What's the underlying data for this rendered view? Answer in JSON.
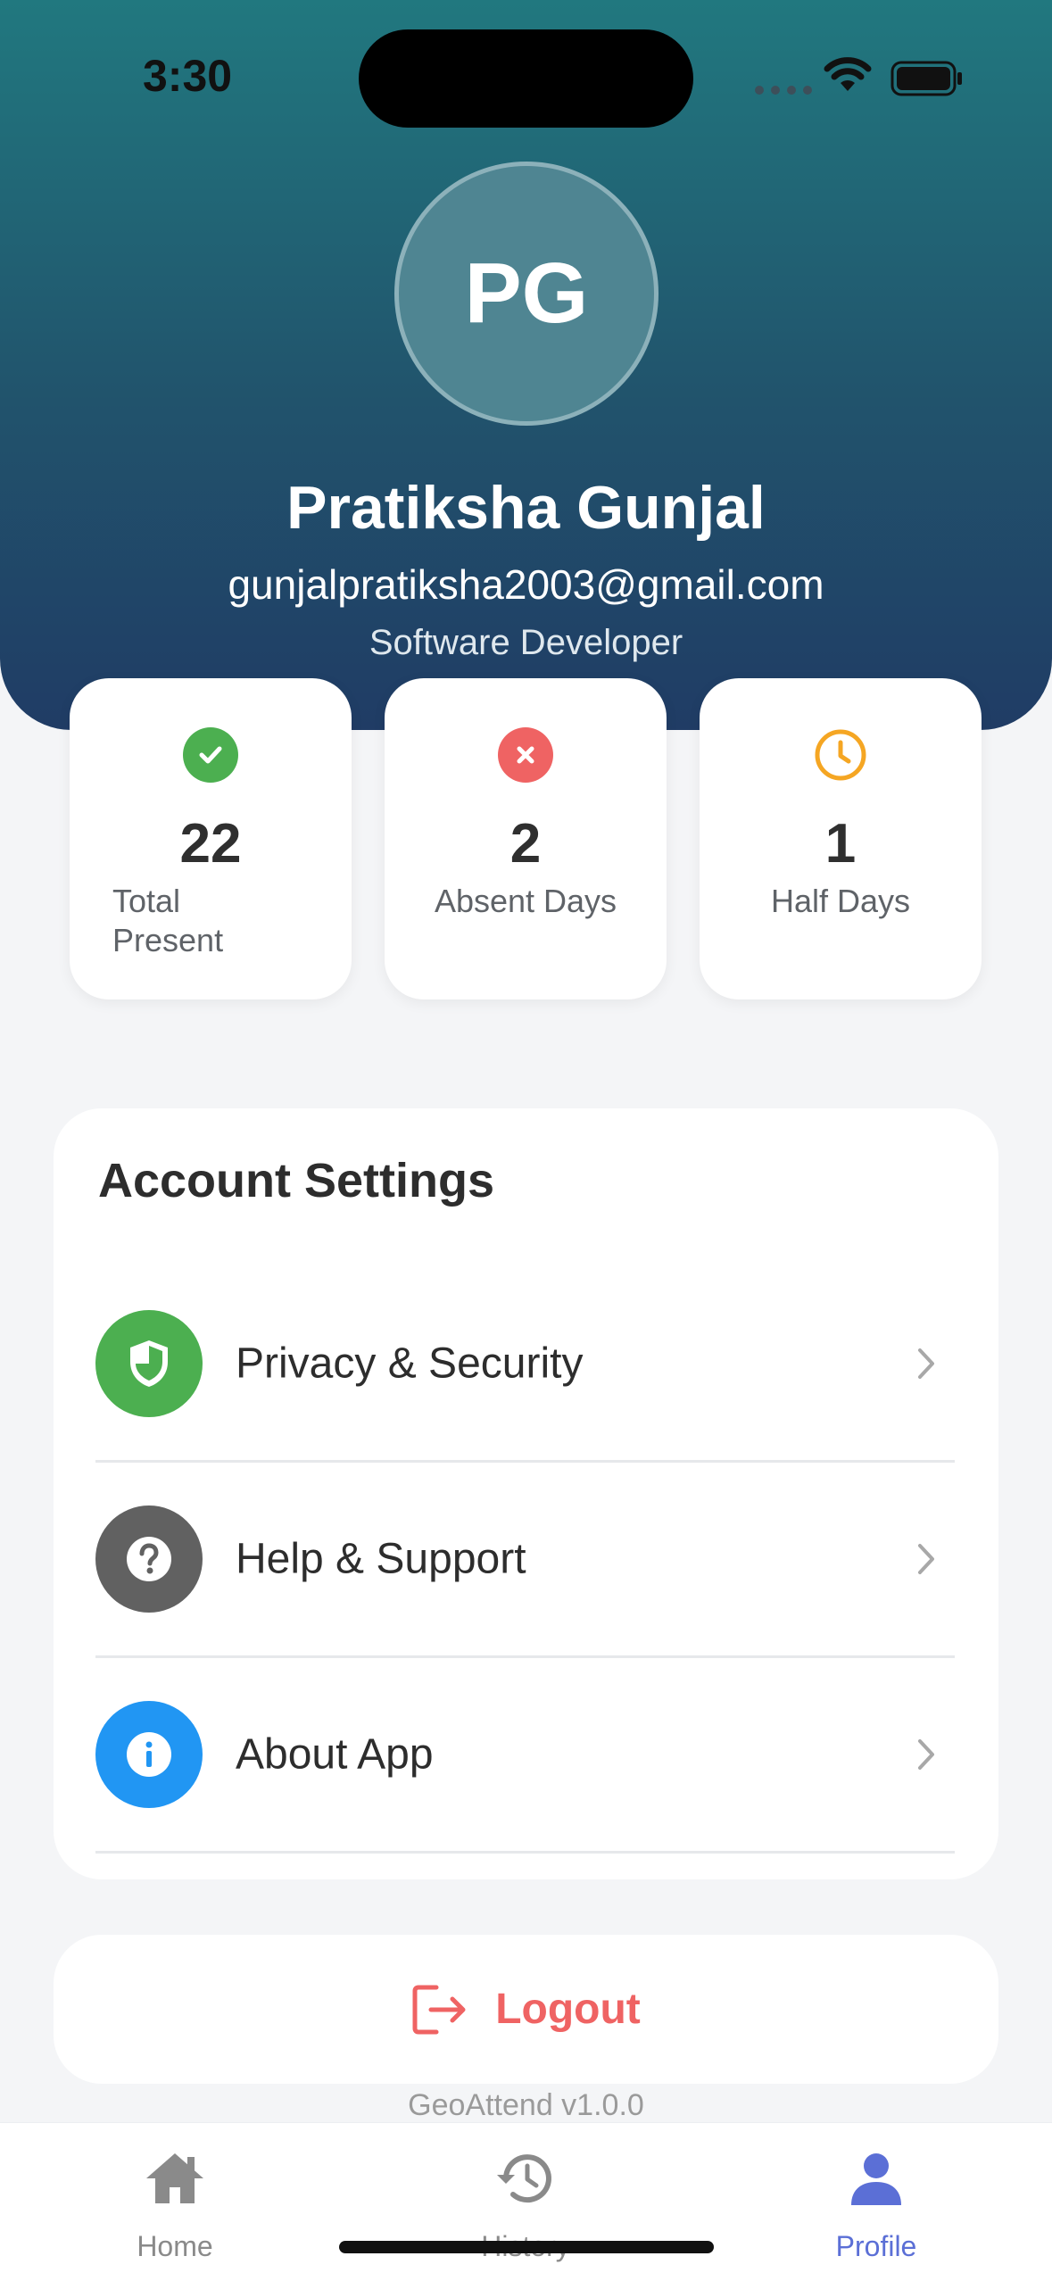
{
  "status_bar": {
    "time": "3:30"
  },
  "profile": {
    "initials": "PG",
    "name": "Pratiksha Gunjal",
    "email": "gunjalpratiksha2003@gmail.com",
    "role": "Software Developer"
  },
  "stats": [
    {
      "value": "22",
      "label": "Total Present",
      "icon": "check-circle-icon",
      "color": "#4caf50"
    },
    {
      "value": "2",
      "label": "Absent Days",
      "icon": "x-circle-icon",
      "color": "#ef6363"
    },
    {
      "value": "1",
      "label": "Half Days",
      "icon": "clock-icon",
      "color": "#f5a623"
    }
  ],
  "account_settings": {
    "title": "Account Settings",
    "items": [
      {
        "label": "Privacy & Security",
        "icon": "shield-icon",
        "color": "#4caf50"
      },
      {
        "label": "Help & Support",
        "icon": "question-icon",
        "color": "#616161"
      },
      {
        "label": "About App",
        "icon": "info-icon",
        "color": "#2196f3"
      }
    ]
  },
  "logout": {
    "label": "Logout",
    "color": "#ef6363"
  },
  "version": "GeoAttend v1.0.0",
  "tabs": [
    {
      "label": "Home",
      "icon": "home-icon"
    },
    {
      "label": "History",
      "icon": "history-icon"
    },
    {
      "label": "Profile",
      "icon": "person-icon",
      "active": true
    }
  ]
}
